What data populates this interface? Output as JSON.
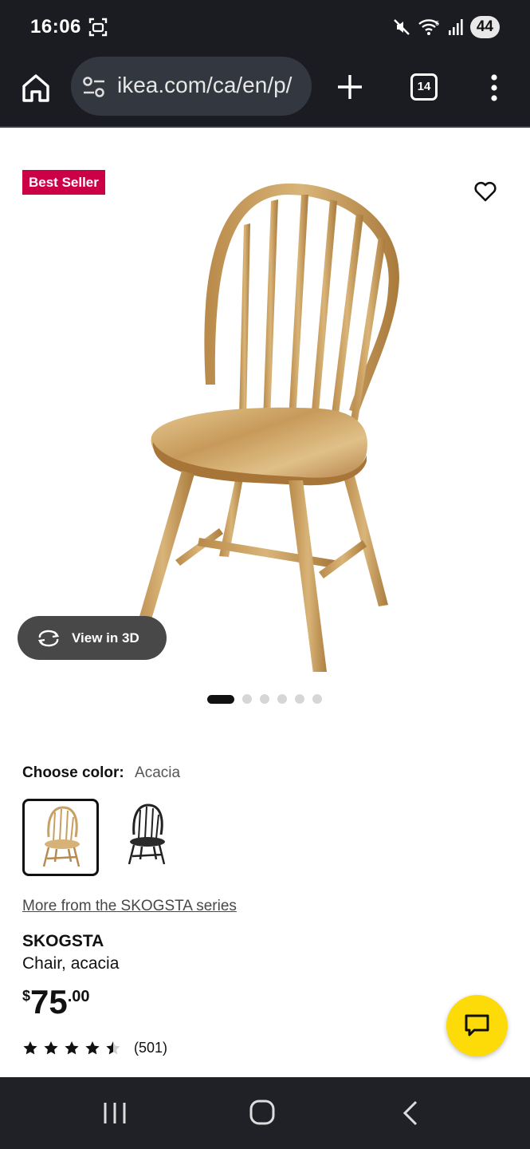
{
  "status_bar": {
    "time": "16:06",
    "battery": "44",
    "icons": [
      "screenshot-icon",
      "mute-icon",
      "wifi-icon",
      "signal-icon"
    ]
  },
  "browser": {
    "url": "ikea.com/ca/en/p/",
    "tab_count": "14",
    "icons": [
      "home-icon",
      "site-settings-icon",
      "plus-icon",
      "tabs-icon",
      "kebab-menu-icon"
    ]
  },
  "product": {
    "badge": "Best Seller",
    "view3d_label": "View in 3D",
    "image_count": 6,
    "active_image": 1,
    "color_label": "Choose color:",
    "color_value": "Acacia",
    "swatches": [
      "Acacia",
      "Black"
    ],
    "series_link": "More from the SKOGSTA series",
    "name": "SKOGSTA",
    "description": "Chair, acacia",
    "price_currency": "$",
    "price_int": "75",
    "price_dec": ".00",
    "rating": 4.5,
    "review_count": "(501)"
  },
  "colors": {
    "badge_bg": "#cc0047",
    "chat_bg": "#fcdb08",
    "chrome_bg": "#1a1c22"
  }
}
